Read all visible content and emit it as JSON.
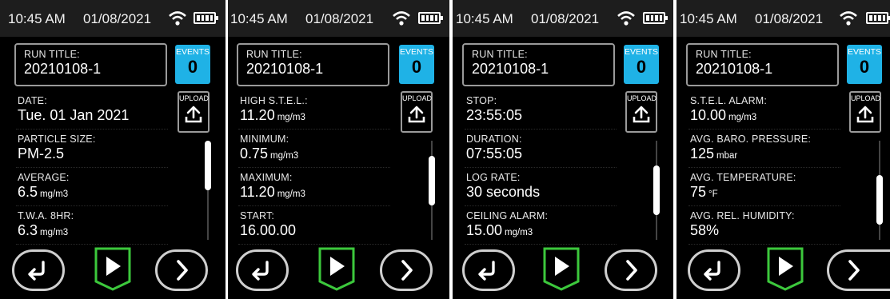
{
  "status": {
    "time": "10:45 AM",
    "date": "01/08/2021"
  },
  "common": {
    "run_title_label": "RUN TITLE:",
    "run_title_value": "20210108-1",
    "events_label": "EVENTS",
    "events_count": "0",
    "upload_label": "UPLOAD"
  },
  "screens": [
    {
      "rows": [
        {
          "label": "DATE:",
          "value": "Tue. 01 Jan 2021",
          "unit": ""
        },
        {
          "label": "PARTICLE SIZE:",
          "value": "PM-2.5",
          "unit": ""
        },
        {
          "label": "AVERAGE:",
          "value": "6.5",
          "unit": "mg/m3"
        },
        {
          "label": "T.W.A. 8HR:",
          "value": "6.3",
          "unit": "mg/m3"
        }
      ],
      "scroll_position": 0.0
    },
    {
      "rows": [
        {
          "label": "HIGH S.T.E.L.:",
          "value": "11.20",
          "unit": "mg/m3"
        },
        {
          "label": "MINIMUM:",
          "value": "0.75",
          "unit": "mg/m3"
        },
        {
          "label": "MAXIMUM:",
          "value": "11.20",
          "unit": "mg/m3"
        },
        {
          "label": "START:",
          "value": "16.00.00",
          "unit": ""
        }
      ],
      "scroll_position": 0.3
    },
    {
      "rows": [
        {
          "label": "STOP:",
          "value": "23:55:05",
          "unit": ""
        },
        {
          "label": "DURATION:",
          "value": "07:55:05",
          "unit": ""
        },
        {
          "label": "LOG RATE:",
          "value": "30 seconds",
          "unit": ""
        },
        {
          "label": "CEILING ALARM:",
          "value": "15.00",
          "unit": "mg/m3"
        }
      ],
      "scroll_position": 0.5
    },
    {
      "rows": [
        {
          "label": "S.T.E.L. ALARM:",
          "value": "10.00",
          "unit": "mg/m3"
        },
        {
          "label": "AVG. BARO. PRESSURE:",
          "value": "125",
          "unit": "mbar"
        },
        {
          "label": "AVG. TEMPERATURE:",
          "value": "75",
          "unit": "°F"
        },
        {
          "label": "AVG. REL. HUMIDITY:",
          "value": "58%",
          "unit": ""
        }
      ],
      "scroll_position": 0.7
    }
  ],
  "icons": {
    "wifi": "wifi-icon",
    "battery": "battery-icon",
    "upload": "upload-icon",
    "back": "back-arrow-icon",
    "play": "play-icon",
    "next": "chevron-right-icon"
  },
  "colors": {
    "screen_bg": "#000000",
    "status_bar": "#1d1d1d",
    "events_badge": "#1fb2e6",
    "play_border": "#3cc83c",
    "button_border": "#cfcfcf"
  }
}
